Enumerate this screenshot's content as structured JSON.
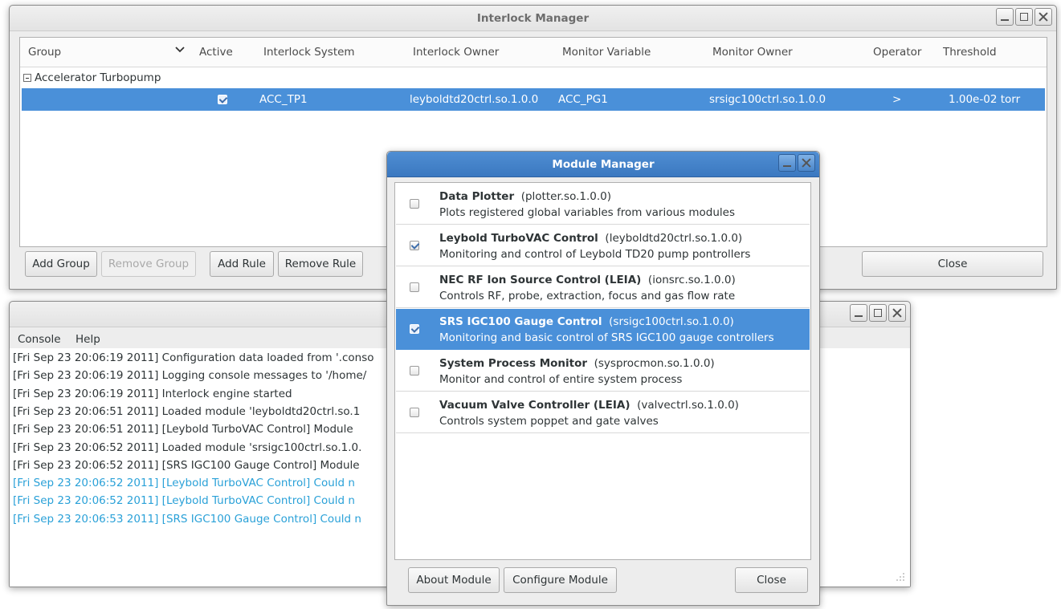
{
  "colors": {
    "selection": "#4a90d9",
    "log_info": "#2e3436",
    "log_warning": "#2aa1d8"
  },
  "interlock": {
    "title": "Interlock Manager",
    "columns": [
      "Group",
      "Active",
      "Interlock System",
      "Interlock Owner",
      "Monitor Variable",
      "Monitor Owner",
      "Operator",
      "Threshold"
    ],
    "group_name": "Accelerator Turbopump",
    "row": {
      "active": true,
      "system": "ACC_TP1",
      "owner": "leyboldtd20ctrl.so.1.0.0",
      "monitor_variable": "ACC_PG1",
      "monitor_owner": "srsigc100ctrl.so.1.0.0",
      "operator": ">",
      "threshold": "1.00e-02 torr"
    },
    "buttons": {
      "add_group": "Add Group",
      "remove_group": "Remove Group",
      "add_rule": "Add Rule",
      "remove_rule": "Remove Rule",
      "close": "Close"
    }
  },
  "console": {
    "menu": {
      "console": "Console",
      "help": "Help"
    },
    "lines": [
      {
        "text": "[Fri Sep 23 20:06:19 2011]  Configuration data loaded from '.conso",
        "level": "info"
      },
      {
        "text": "[Fri Sep 23 20:06:19 2011]  Logging console messages to  '/home/",
        "level": "info"
      },
      {
        "text": "[Fri Sep 23 20:06:19 2011]  Interlock engine started",
        "level": "info"
      },
      {
        "text": "[Fri Sep 23 20:06:51 2011]  Loaded module  'leyboldtd20ctrl.so.1",
        "level": "info"
      },
      {
        "text": "[Fri Sep 23 20:06:51 2011]  [Leybold TurboVAC Control] Module",
        "level": "info"
      },
      {
        "text": "[Fri Sep 23 20:06:52 2011]  Loaded module  'srsigc100ctrl.so.1.0.",
        "level": "info"
      },
      {
        "text": "[Fri Sep 23 20:06:52 2011]  [SRS IGC100 Gauge Control] Module",
        "level": "info"
      },
      {
        "text": "[Fri Sep 23 20:06:52 2011]  [Leybold TurboVAC Control] Could n",
        "level": "warning"
      },
      {
        "text": "[Fri Sep 23 20:06:52 2011]  [Leybold TurboVAC Control] Could n",
        "level": "warning"
      },
      {
        "text": "[Fri Sep 23 20:06:53 2011]  [SRS IGC100 Gauge Control] Could n",
        "level": "warning"
      }
    ]
  },
  "module_manager": {
    "title": "Module Manager",
    "modules": [
      {
        "name": "Data Plotter",
        "file": "(plotter.so.1.0.0)",
        "description": "Plots registered global variables from various modules",
        "enabled": false,
        "selected": false
      },
      {
        "name": "Leybold TurboVAC Control",
        "file": "(leyboldtd20ctrl.so.1.0.0)",
        "description": "Monitoring and control of Leybold TD20 pump pontrollers",
        "enabled": true,
        "selected": false
      },
      {
        "name": "NEC RF Ion Source Control (LEIA)",
        "file": "(ionsrc.so.1.0.0)",
        "description": "Controls RF, probe, extraction, focus and gas flow rate",
        "enabled": false,
        "selected": false
      },
      {
        "name": "SRS IGC100 Gauge Control",
        "file": "(srsigc100ctrl.so.1.0.0)",
        "description": "Monitoring and basic control of SRS IGC100 gauge controllers",
        "enabled": true,
        "selected": true
      },
      {
        "name": "System Process Monitor",
        "file": "(sysprocmon.so.1.0.0)",
        "description": "Monitor and control of entire system process",
        "enabled": false,
        "selected": false
      },
      {
        "name": "Vacuum Valve Controller (LEIA)",
        "file": "(valvectrl.so.1.0.0)",
        "description": "Controls system poppet and gate valves",
        "enabled": false,
        "selected": false
      }
    ],
    "buttons": {
      "about": "About Module",
      "configure": "Configure Module",
      "close": "Close"
    }
  }
}
